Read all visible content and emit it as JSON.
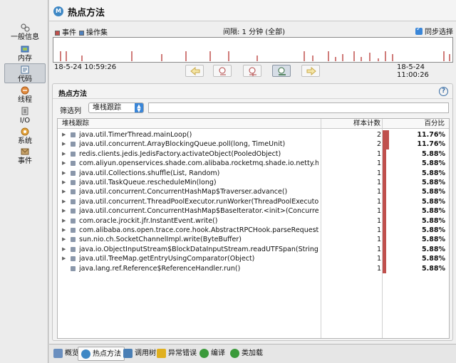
{
  "sidebar": {
    "items": [
      {
        "label": "一般信息",
        "icon": "general-info-icon"
      },
      {
        "label": "内存",
        "icon": "memory-icon"
      },
      {
        "label": "代码",
        "icon": "code-icon",
        "active": true
      },
      {
        "label": "线程",
        "icon": "threads-icon"
      },
      {
        "label": "I/O",
        "icon": "io-icon"
      },
      {
        "label": "系统",
        "icon": "system-icon"
      },
      {
        "label": "事件",
        "icon": "events-icon"
      }
    ]
  },
  "header": {
    "title": "热点方法",
    "icon": "hot-methods-icon"
  },
  "timeline": {
    "legend_events": "事件",
    "legend_operations": "操作集",
    "interval": "间隔: 1 分钟 (全部)",
    "sync_label": "同步选择",
    "sync_checked": true,
    "start_time": "18-5-24 10:59:26",
    "end_time": "18-5-24 11:00:26",
    "event_color": "#c0504d",
    "ops_color": "#4f81bd"
  },
  "panel": {
    "title": "热点方法",
    "filter_label": "筛选列",
    "filter_value": "堆栈跟踪",
    "filter_text": ""
  },
  "table": {
    "columns": [
      "堆栈跟踪",
      "样本计数",
      "百分比"
    ],
    "rows": [
      {
        "method": "java.util.TimerThread.mainLoop()",
        "count": "2",
        "percent": "11.76%",
        "fraction": 0.1176,
        "expandable": true
      },
      {
        "method": "java.util.concurrent.ArrayBlockingQueue.poll(long, TimeUnit)",
        "count": "2",
        "percent": "11.76%",
        "fraction": 0.1176,
        "expandable": true
      },
      {
        "method": "redis.clients.jedis.JedisFactory.activateObject(PooledObject)",
        "count": "1",
        "percent": "5.88%",
        "fraction": 0.0588,
        "expandable": true
      },
      {
        "method": "com.aliyun.openservices.shade.com.alibaba.rocketmq.shade.io.netty.handler....",
        "count": "1",
        "percent": "5.88%",
        "fraction": 0.0588,
        "expandable": true
      },
      {
        "method": "java.util.Collections.shuffle(List, Random)",
        "count": "1",
        "percent": "5.88%",
        "fraction": 0.0588,
        "expandable": true
      },
      {
        "method": "java.util.TaskQueue.rescheduleMin(long)",
        "count": "1",
        "percent": "5.88%",
        "fraction": 0.0588,
        "expandable": true
      },
      {
        "method": "java.util.concurrent.ConcurrentHashMap$Traverser.advance()",
        "count": "1",
        "percent": "5.88%",
        "fraction": 0.0588,
        "expandable": true
      },
      {
        "method": "java.util.concurrent.ThreadPoolExecutor.runWorker(ThreadPoolExecutor$Worker)",
        "count": "1",
        "percent": "5.88%",
        "fraction": 0.0588,
        "expandable": true
      },
      {
        "method": "java.util.concurrent.ConcurrentHashMap$BaseIterator.<init>(ConcurrentHash...",
        "count": "1",
        "percent": "5.88%",
        "fraction": 0.0588,
        "expandable": true
      },
      {
        "method": "com.oracle.jrockit.jfr.InstantEvent.write()",
        "count": "1",
        "percent": "5.88%",
        "fraction": 0.0588,
        "expandable": true
      },
      {
        "method": "com.alibaba.ons.open.trace.core.hook.AbstractRPCHook.parseRequestConte...",
        "count": "1",
        "percent": "5.88%",
        "fraction": 0.0588,
        "expandable": true
      },
      {
        "method": "sun.nio.ch.SocketChannelImpl.write(ByteBuffer)",
        "count": "1",
        "percent": "5.88%",
        "fraction": 0.0588,
        "expandable": true
      },
      {
        "method": "java.io.ObjectInputStream$BlockDataInputStream.readUTFSpan(StringBuilder, long)",
        "count": "1",
        "percent": "5.88%",
        "fraction": 0.0588,
        "expandable": true
      },
      {
        "method": "java.util.TreeMap.getEntryUsingComparator(Object)",
        "count": "1",
        "percent": "5.88%",
        "fraction": 0.0588,
        "expandable": true
      },
      {
        "method": "java.lang.ref.Reference$ReferenceHandler.run()",
        "count": "1",
        "percent": "5.88%",
        "fraction": 0.0588,
        "expandable": false
      }
    ]
  },
  "bottom_tabs": [
    {
      "label": "概览",
      "icon": "overview-icon",
      "color": "#6a8fbf"
    },
    {
      "label": "热点方法",
      "icon": "hot-methods-icon",
      "color": "#3f88c5",
      "active": true
    },
    {
      "label": "调用树",
      "icon": "call-tree-icon",
      "color": "#4a7fb5"
    },
    {
      "label": "异常错误",
      "icon": "exception-icon",
      "color": "#e0b020"
    },
    {
      "label": "编译",
      "icon": "compile-icon",
      "color": "#3b9a3b"
    },
    {
      "label": "类加载",
      "icon": "class-loading-icon",
      "color": "#3b9a3b"
    }
  ]
}
